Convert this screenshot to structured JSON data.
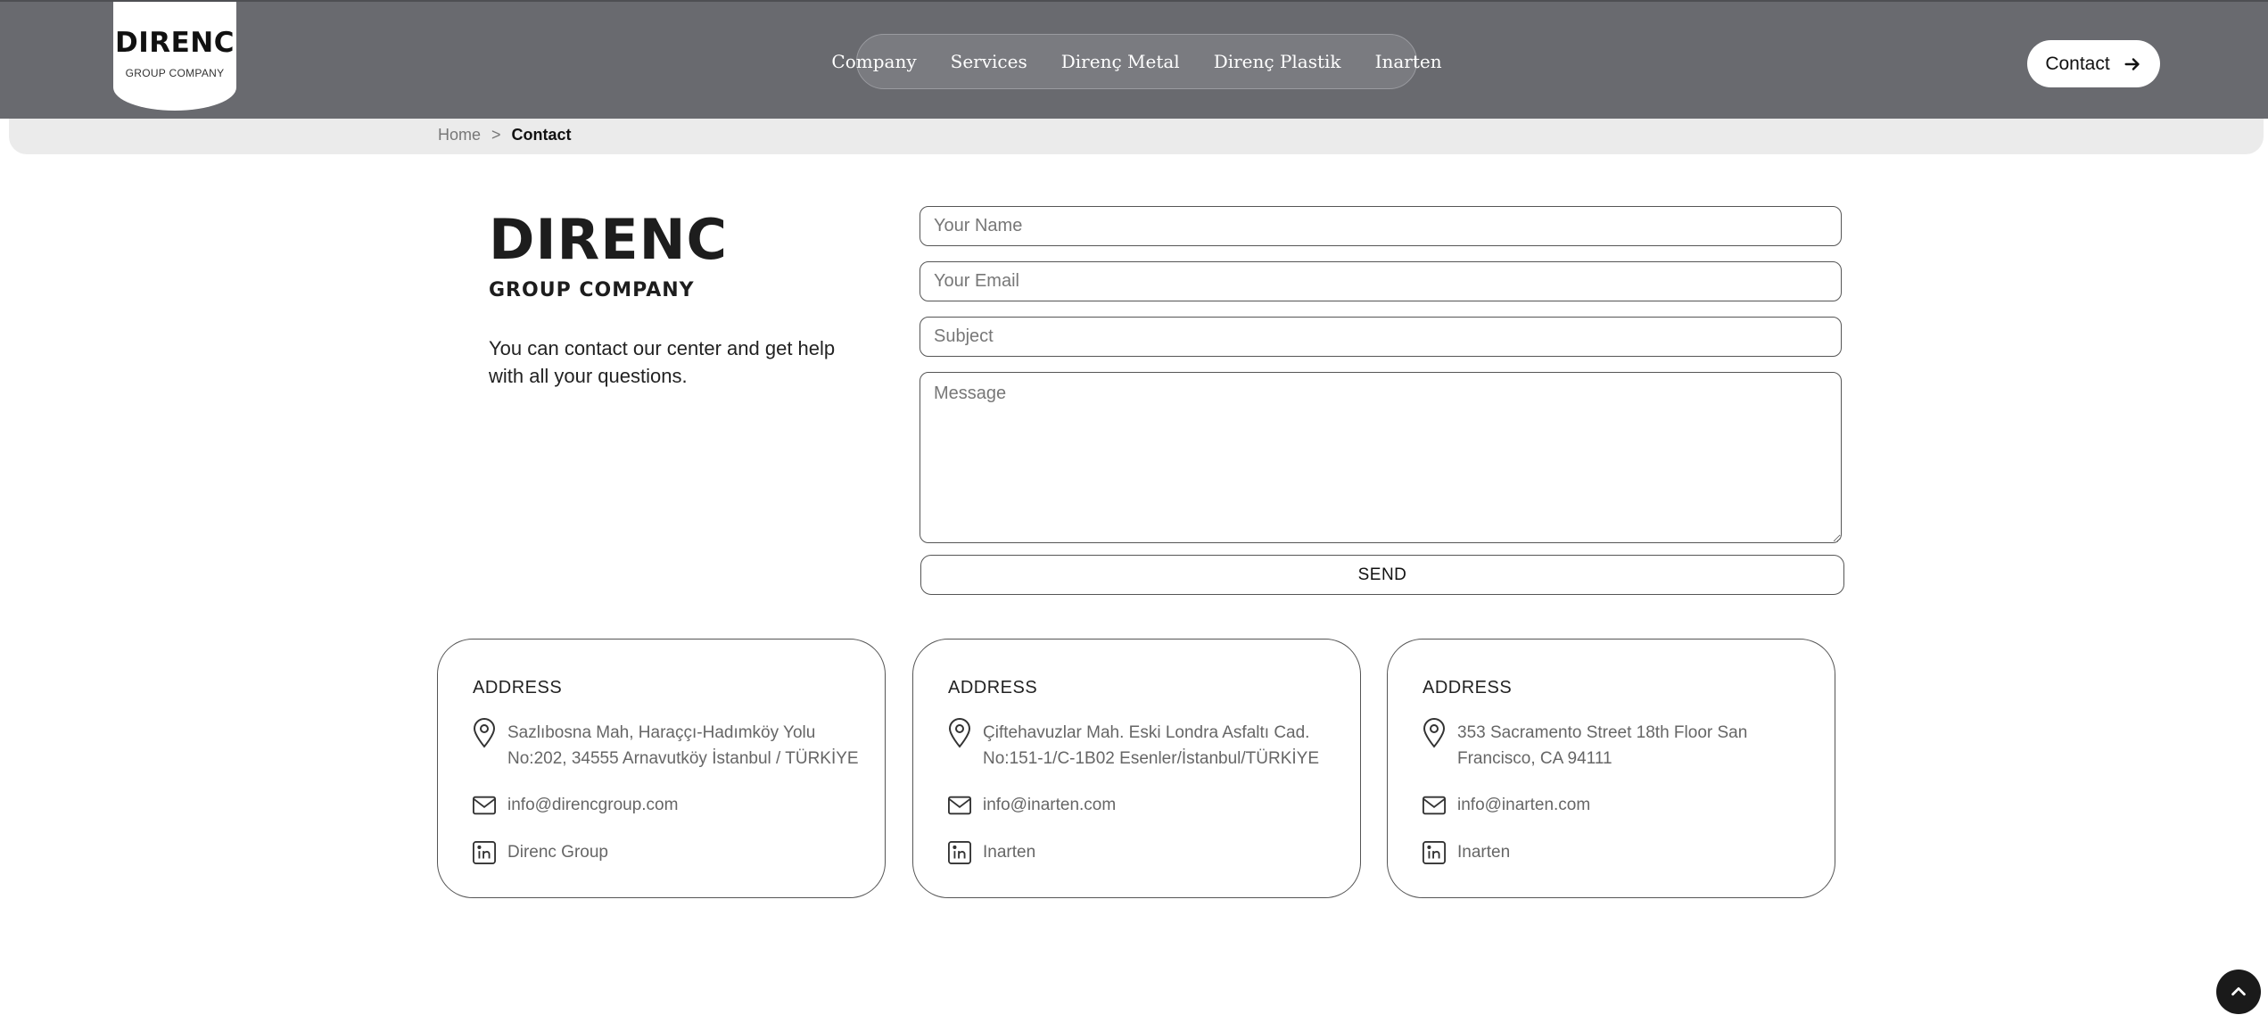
{
  "header": {
    "logo": {
      "title": "DIRENC",
      "subtitle": "GROUP COMPANY"
    },
    "nav": [
      "Company",
      "Services",
      "Direnç Metal",
      "Direnç Plastik",
      "Inarten"
    ],
    "contact_button": "Contact"
  },
  "breadcrumb": {
    "home": "Home",
    "separator": ">",
    "current": "Contact"
  },
  "intro": {
    "title": "DIRENC",
    "subtitle": "GROUP COMPANY",
    "text": "You can contact our center and get help with all your questions."
  },
  "form": {
    "name_placeholder": "Your Name",
    "email_placeholder": "Your Email",
    "subject_placeholder": "Subject",
    "message_placeholder": "Message",
    "send_label": "SEND"
  },
  "cards": [
    {
      "title": "ADDRESS",
      "address": "Sazlıbosna Mah, Haraççı-Hadımköy Yolu No:202, 34555 Arnavutköy İstanbul / TÜRKİYE",
      "email": "info@direncgroup.com",
      "linkedin": "Direnc Group"
    },
    {
      "title": "ADDRESS",
      "address": "Çiftehavuzlar Mah. Eski Londra Asfaltı Cad. No:151-1/C-1B02 Esenler/İstanbul/TÜRKİYE",
      "email": "info@inarten.com",
      "linkedin": "Inarten"
    },
    {
      "title": "ADDRESS",
      "address": "353 Sacramento Street 18th Floor San Francisco, CA 94111",
      "email": "info@inarten.com",
      "linkedin": "Inarten"
    }
  ],
  "icons": {
    "location": "location-pin-icon",
    "email": "envelope-icon",
    "linkedin": "linkedin-icon",
    "arrow": "arrow-right-icon",
    "scroll_top": "chevron-up-icon"
  }
}
